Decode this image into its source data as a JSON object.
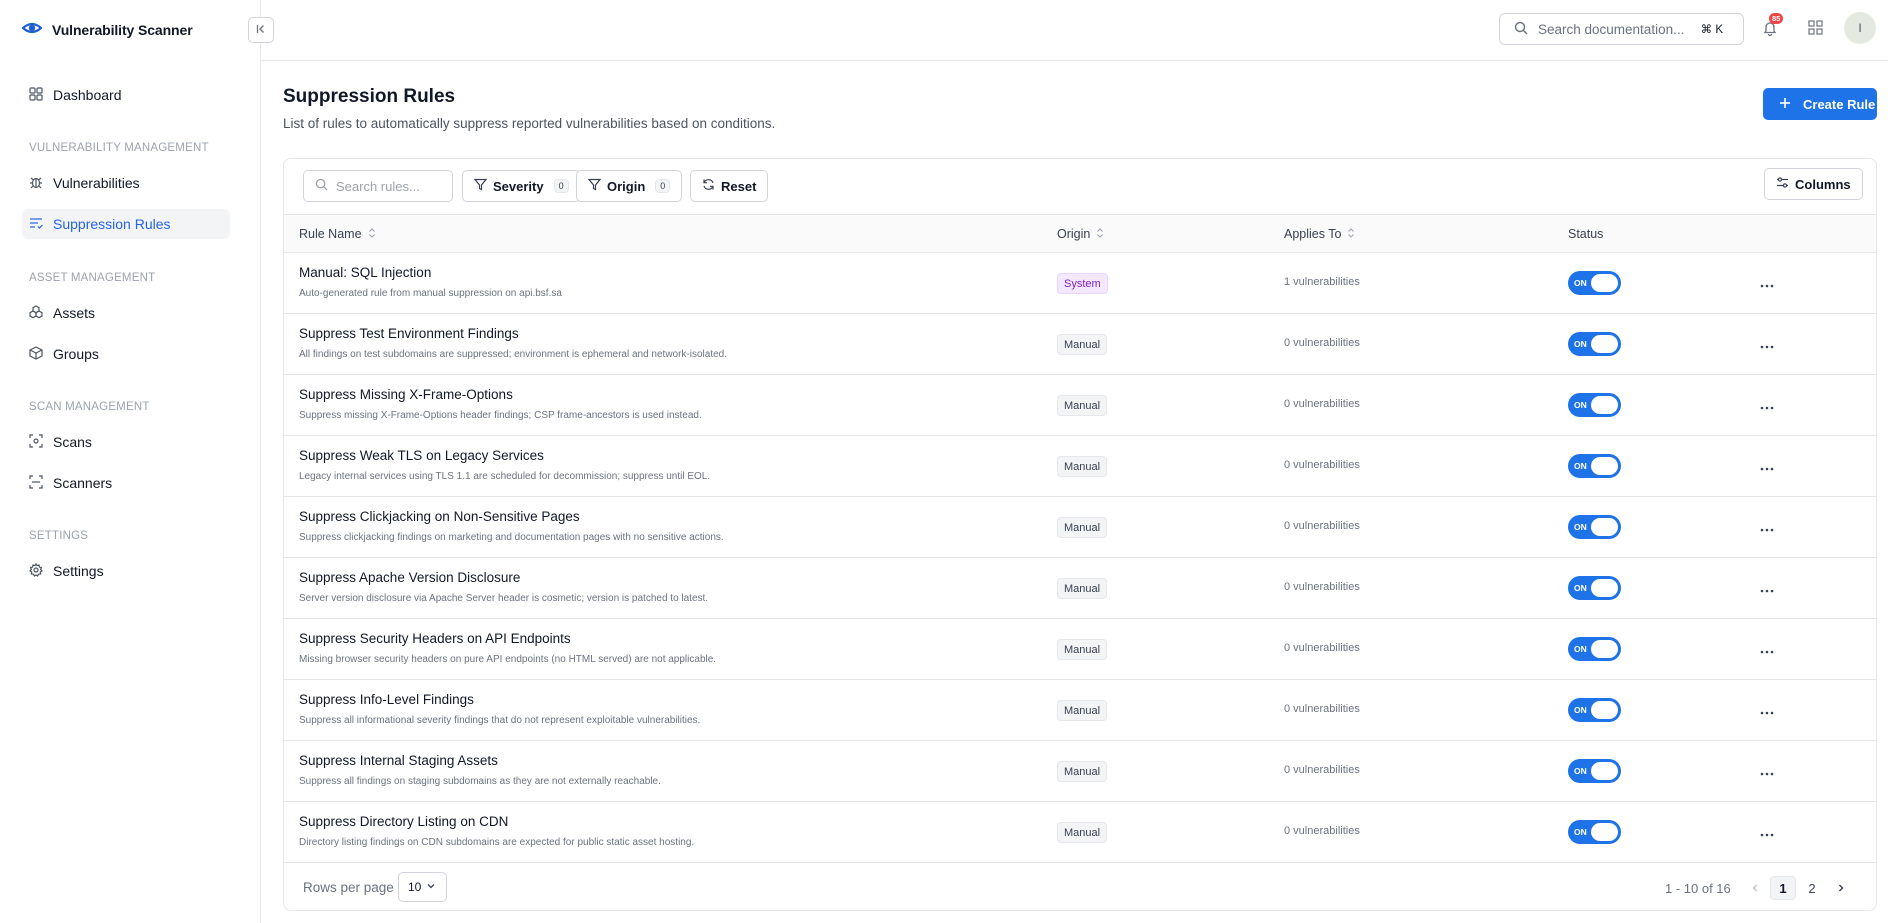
{
  "app": {
    "name": "Vulnerability Scanner"
  },
  "sidebar": {
    "dashboard": "Dashboard",
    "sections": {
      "vuln_mgmt": "VULNERABILITY MANAGEMENT",
      "asset_mgmt": "ASSET MANAGEMENT",
      "scan_mgmt": "SCAN MANAGEMENT",
      "settings": "SETTINGS"
    },
    "items": {
      "vulnerabilities": "Vulnerabilities",
      "suppression_rules": "Suppression Rules",
      "assets": "Assets",
      "groups": "Groups",
      "scans": "Scans",
      "scanners": "Scanners",
      "settings": "Settings"
    },
    "active_item": "Suppression Rules"
  },
  "topbar": {
    "search_placeholder": "Search documentation...",
    "shortcut": "⌘ K",
    "notification_count": "85",
    "avatar_initial": "I"
  },
  "page": {
    "title": "Suppression Rules",
    "subtitle": "List of rules to automatically suppress reported vulnerabilities based on conditions.",
    "create_button": "Create Rule"
  },
  "toolbar": {
    "search_placeholder": "Search rules...",
    "severity_label": "Severity",
    "severity_count": "0",
    "origin_label": "Origin",
    "origin_count": "0",
    "reset_label": "Reset",
    "columns_label": "Columns"
  },
  "table": {
    "headers": {
      "name": "Rule Name",
      "origin": "Origin",
      "applies": "Applies To",
      "status": "Status"
    },
    "rows": [
      {
        "name": "Manual: SQL Injection",
        "desc": "Auto-generated rule from manual suppression on api.bsf.sa",
        "origin": "System",
        "applies": "1 vulnerabilities",
        "status": "ON"
      },
      {
        "name": "Suppress Test Environment Findings",
        "desc": "All findings on test subdomains are suppressed; environment is ephemeral and network-isolated.",
        "origin": "Manual",
        "applies": "0 vulnerabilities",
        "status": "ON"
      },
      {
        "name": "Suppress Missing X-Frame-Options",
        "desc": "Suppress missing X-Frame-Options header findings; CSP frame-ancestors is used instead.",
        "origin": "Manual",
        "applies": "0 vulnerabilities",
        "status": "ON"
      },
      {
        "name": "Suppress Weak TLS on Legacy Services",
        "desc": "Legacy internal services using TLS 1.1 are scheduled for decommission; suppress until EOL.",
        "origin": "Manual",
        "applies": "0 vulnerabilities",
        "status": "ON"
      },
      {
        "name": "Suppress Clickjacking on Non-Sensitive Pages",
        "desc": "Suppress clickjacking findings on marketing and documentation pages with no sensitive actions.",
        "origin": "Manual",
        "applies": "0 vulnerabilities",
        "status": "ON"
      },
      {
        "name": "Suppress Apache Version Disclosure",
        "desc": "Server version disclosure via Apache Server header is cosmetic; version is patched to latest.",
        "origin": "Manual",
        "applies": "0 vulnerabilities",
        "status": "ON"
      },
      {
        "name": "Suppress Security Headers on API Endpoints",
        "desc": "Missing browser security headers on pure API endpoints (no HTML served) are not applicable.",
        "origin": "Manual",
        "applies": "0 vulnerabilities",
        "status": "ON"
      },
      {
        "name": "Suppress Info-Level Findings",
        "desc": "Suppress all informational severity findings that do not represent exploitable vulnerabilities.",
        "origin": "Manual",
        "applies": "0 vulnerabilities",
        "status": "ON"
      },
      {
        "name": "Suppress Internal Staging Assets",
        "desc": "Suppress all findings on staging subdomains as they are not externally reachable.",
        "origin": "Manual",
        "applies": "0 vulnerabilities",
        "status": "ON"
      },
      {
        "name": "Suppress Directory Listing on CDN",
        "desc": "Directory listing findings on CDN subdomains are expected for public static asset hosting.",
        "origin": "Manual",
        "applies": "0 vulnerabilities",
        "status": "ON"
      }
    ]
  },
  "pagination": {
    "rows_per_page_label": "Rows per page",
    "rows_per_page_value": "10",
    "range": "1 - 10 of 16",
    "pages": [
      "1",
      "2"
    ],
    "current_page": "1"
  },
  "colors": {
    "accent": "#1f73e8",
    "system_badge": "#7e22ce",
    "notification": "#ef4444"
  }
}
